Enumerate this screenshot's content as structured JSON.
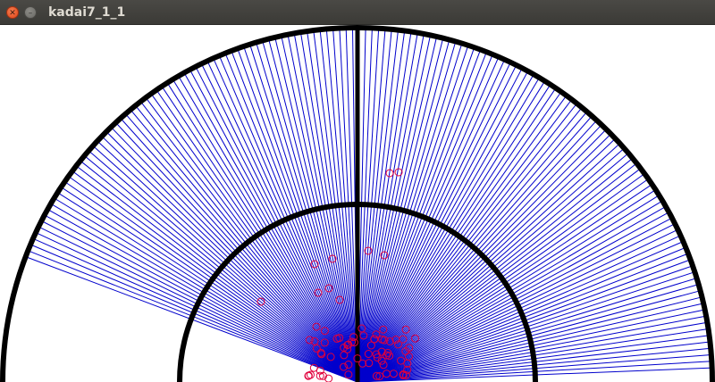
{
  "window": {
    "title": "kadai7_1_1",
    "close_icon": "close-icon",
    "minimize_icon": "minimize-icon"
  },
  "scene": {
    "ray_color": "#0000cc",
    "particle_color": "#e0003c",
    "arc_color": "#000000",
    "background": "#ffffff"
  }
}
